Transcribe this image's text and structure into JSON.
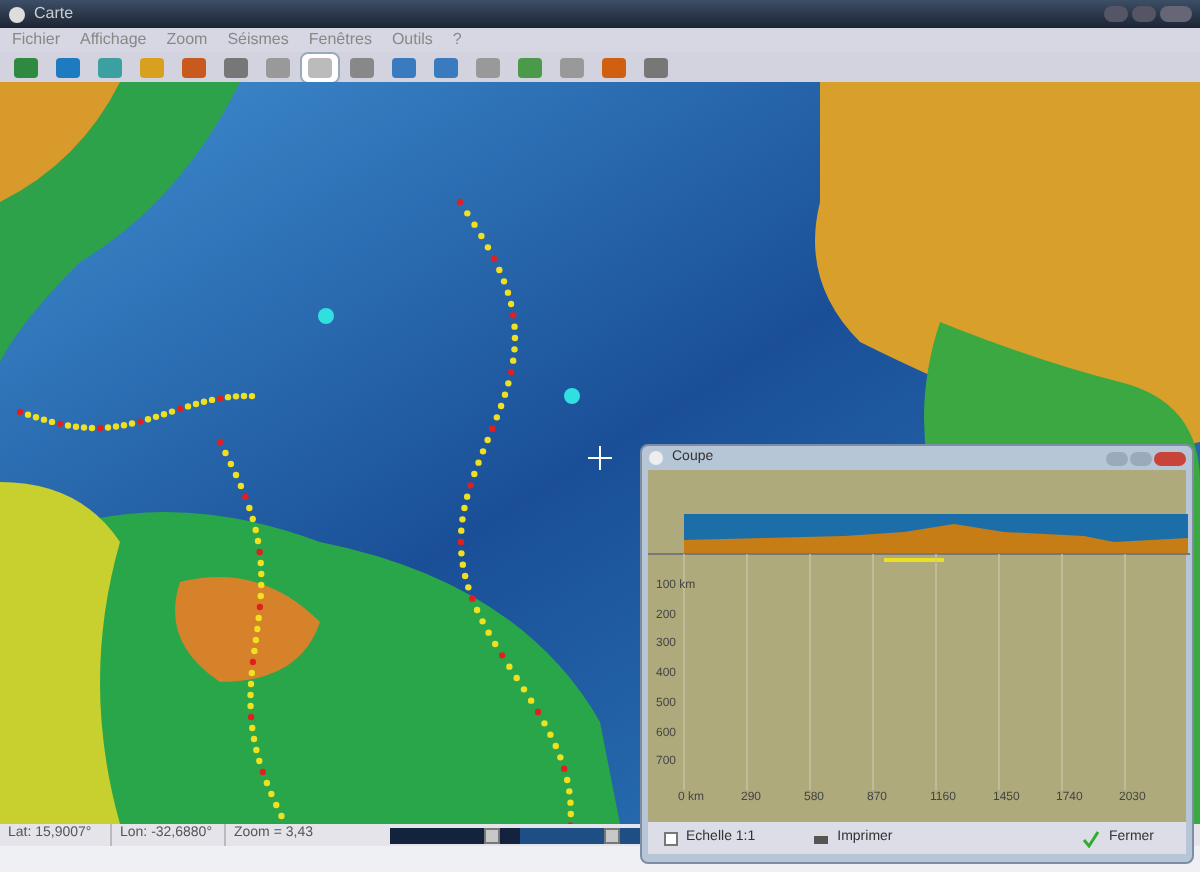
{
  "window": {
    "title": "Carte"
  },
  "menu": [
    "Fichier",
    "Affichage",
    "Zoom",
    "Séismes",
    "Fenêtres",
    "Outils",
    "?"
  ],
  "toolbar": [
    {
      "selected": false
    },
    {
      "selected": false
    },
    {
      "selected": false
    },
    {
      "selected": false
    },
    {
      "selected": false
    },
    {
      "selected": false
    },
    {
      "selected": false
    },
    {
      "selected": true
    },
    {
      "selected": false
    },
    {
      "selected": false
    },
    {
      "selected": false
    },
    {
      "selected": false
    },
    {
      "selected": false
    },
    {
      "selected": false
    },
    {
      "selected": false
    },
    {
      "selected": false
    }
  ],
  "status_bar": {
    "lat": "Lat: 15,9007°",
    "lon": "Lon: -32,6880°",
    "zoom": "Zoom = 3,43",
    "sliders": [
      {
        "level": 0.78
      },
      {
        "level": 0.7
      }
    ]
  },
  "profile_window": {
    "title": "Coupe",
    "yticks": [
      "100 km",
      "200",
      "300",
      "400",
      "500",
      "600",
      "700"
    ],
    "xticks": [
      "0 km",
      "290",
      "580",
      "870",
      "1160",
      "1450",
      "1740",
      "2030"
    ],
    "scale_checkbox": {
      "label": "Echelle 1:1",
      "checked": false
    },
    "print_button": "Imprimer",
    "close_button": "Fermer"
  }
}
